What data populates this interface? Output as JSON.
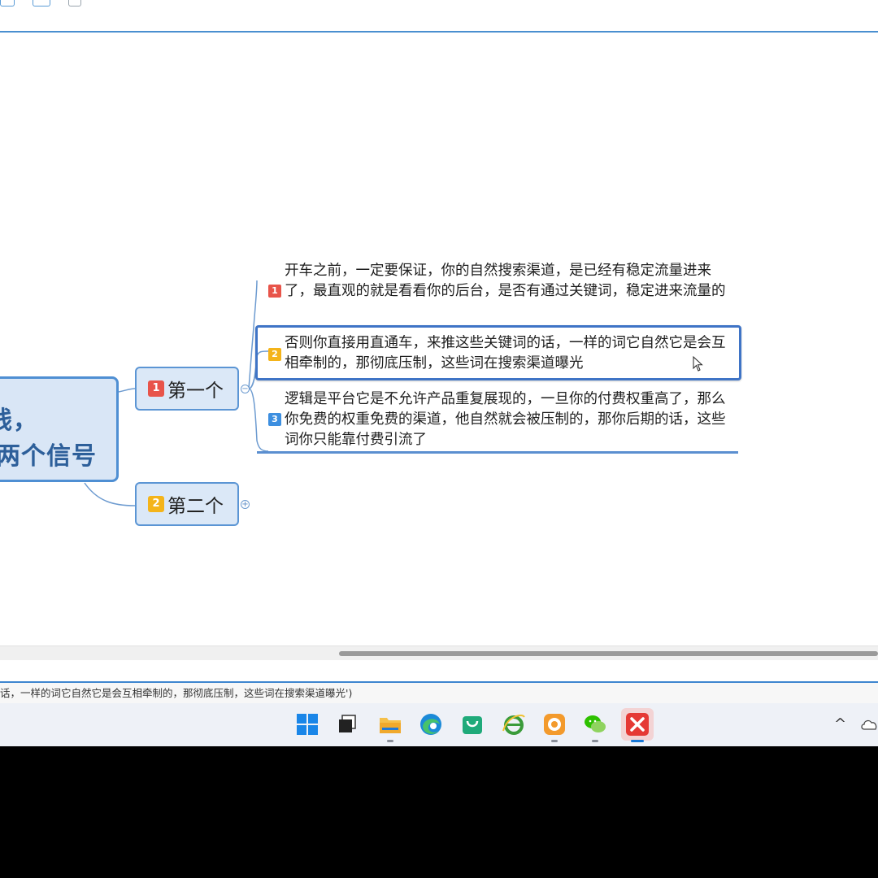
{
  "mindmap": {
    "central_topic": {
      "line1": "线，",
      "line2": "两个信号"
    },
    "branches": [
      {
        "badge": "1",
        "label": "第一个",
        "toggle": "−"
      },
      {
        "badge": "2",
        "label": "第二个",
        "toggle": "+"
      }
    ],
    "subtopics": [
      {
        "badge": "1",
        "text": "开车之前，一定要保证，你的自然搜索渠道，是已经有稳定流量进来了，最直观的就是看看你的后台，是否有通过关键词，稳定进来流量的"
      },
      {
        "badge": "2",
        "text": "否则你直接用直通车，来推这些关键词的话，一样的词它自然它是会互相牵制的，那彻底压制，这些词在搜索渠道曝光"
      },
      {
        "badge": "3",
        "text": "逻辑是平台它是不允许产品重复展现的，一旦你的付费权重高了，那么你免费的权重免费的渠道，他自然就会被压制的，那你后期的话，这些词你只能靠付费引流了"
      }
    ]
  },
  "statusbar": {
    "text": "话，一样的词它自然它是会互相牵制的，那彻底压制，这些词在搜索渠道曝光')"
  },
  "taskbar": {
    "tray_chevron": "^",
    "apps": [
      "windows-start",
      "task-view",
      "file-explorer",
      "edge",
      "shopping-app",
      "ie",
      "game-app",
      "wechat",
      "xmind"
    ]
  },
  "colors": {
    "accent": "#4f8fd3",
    "badge_red": "#e8544a",
    "badge_yellow": "#f4b41a",
    "badge_blue": "#3d8fe0"
  }
}
